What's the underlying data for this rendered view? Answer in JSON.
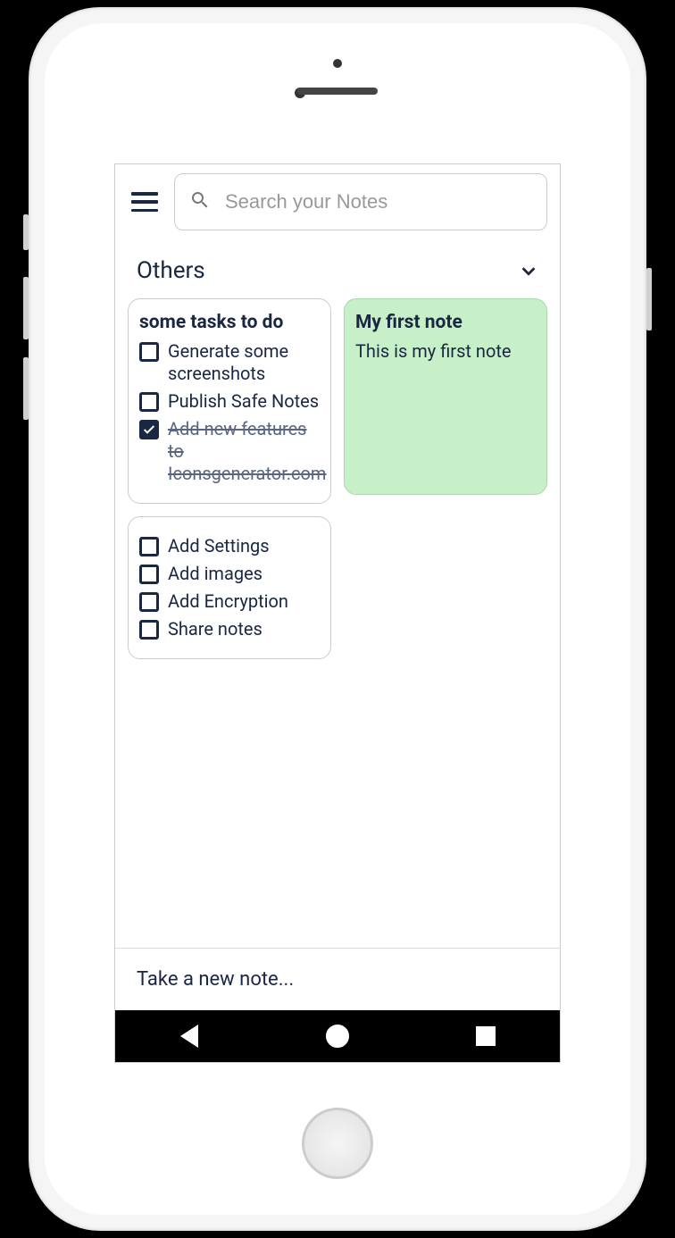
{
  "search": {
    "placeholder": "Search your Notes"
  },
  "section": {
    "title": "Others"
  },
  "notes": [
    {
      "title": "some tasks to do",
      "type": "checklist",
      "bg": "white",
      "items": [
        {
          "text": "Generate some screenshots",
          "done": false
        },
        {
          "text": "Publish Safe Notes",
          "done": false
        },
        {
          "text": "Add new features to Iconsgenerator.com",
          "done": true
        }
      ]
    },
    {
      "title": "My first note",
      "type": "text",
      "bg": "green",
      "body": "This is my first note"
    },
    {
      "title": "",
      "type": "checklist",
      "bg": "white",
      "items": [
        {
          "text": "Add Settings",
          "done": false
        },
        {
          "text": "Add images",
          "done": false
        },
        {
          "text": "Add Encryption",
          "done": false
        },
        {
          "text": "Share notes",
          "done": false
        }
      ]
    }
  ],
  "footer": {
    "new_note": "Take a new note..."
  }
}
